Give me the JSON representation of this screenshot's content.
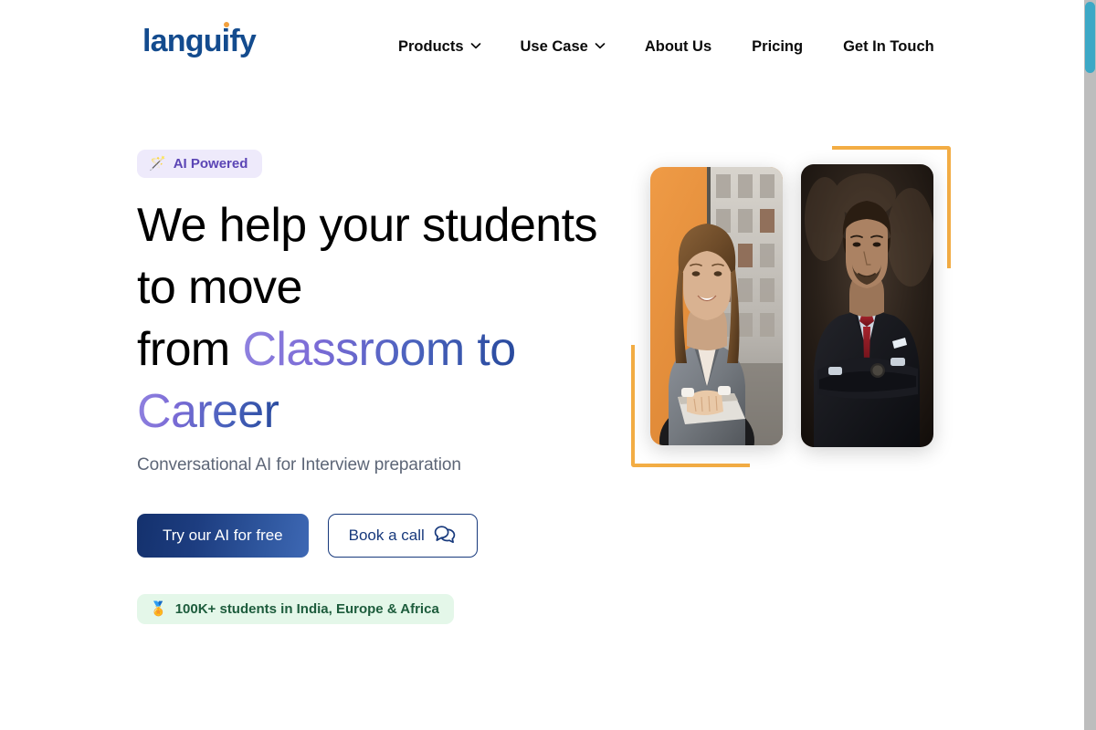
{
  "brand": {
    "logo_text_before": "langu",
    "logo_text_i": "i",
    "logo_text_after": "fy",
    "logo_full": "languify",
    "logo_color": "#134b8e",
    "logo_dot_color": "#f2a03d"
  },
  "nav": {
    "items": [
      {
        "label": "Products",
        "has_chevron": true,
        "icon": "chevron-down-icon"
      },
      {
        "label": "Use Case",
        "has_chevron": true,
        "icon": "chevron-down-icon"
      },
      {
        "label": "About Us",
        "has_chevron": false
      },
      {
        "label": "Pricing",
        "has_chevron": false
      },
      {
        "label": "Get In Touch",
        "has_chevron": false
      }
    ]
  },
  "hero": {
    "badge_ai": {
      "emoji": "🪄",
      "icon": "magic-wand-icon",
      "label": "AI Powered",
      "bg": "#eeeafb",
      "fg": "#5b45b5"
    },
    "headline": {
      "line1": "We help your students",
      "line2": "to move",
      "line3_plain": "from ",
      "line3_gradient": "Classroom to",
      "line4_gradient": "Career",
      "gradient_from": "#9183e0",
      "gradient_to": "#27499c"
    },
    "subheadline": "Conversational AI for Interview preparation",
    "cta": {
      "primary_label": "Try our AI for free",
      "primary_gradient_from": "#14316d",
      "primary_gradient_to": "#3e68b4",
      "secondary_label": "Book a call",
      "secondary_icon": "chat-bubbles-icon",
      "secondary_color": "#17397c"
    },
    "badge_students": {
      "emoji": "🏅",
      "icon": "medal-icon",
      "label": "100K+ students in India, Europe & Africa",
      "bg": "#e4f7e9",
      "fg": "#1d5c3c"
    },
    "media": {
      "photo_1_alt": "Smiling woman in grey blazer holding a laptop, orange wall and office window behind",
      "photo_2_alt": "Man in dark suit with red tie, arms crossed, dark moody background",
      "bracket_color": "#f3ad44"
    }
  },
  "scrollbar": {
    "thumb_color": "#3ca8c6",
    "track_color": "#bdbdbd",
    "position": "top"
  }
}
